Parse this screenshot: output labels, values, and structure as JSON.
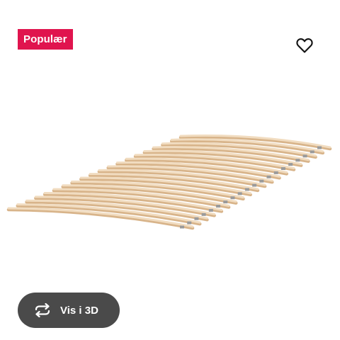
{
  "badge": {
    "label": "Populær",
    "color": "#e0144e"
  },
  "favorite": {
    "icon": "heart-outline-icon"
  },
  "product_image": {
    "subject": "slatted bed base"
  },
  "view3d": {
    "label": "Vis i 3D",
    "icon": "rotate-3d-icon",
    "background": "#4a4a4a"
  }
}
